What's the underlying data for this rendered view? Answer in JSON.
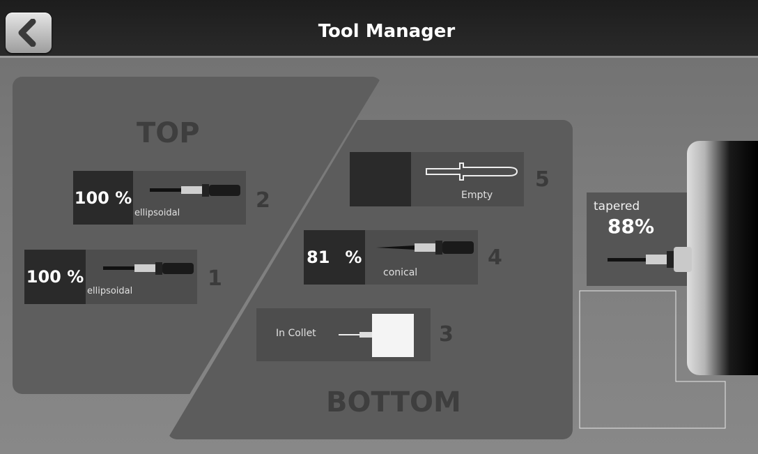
{
  "header": {
    "title": "Tool Manager",
    "back_icon": "back-arrow-icon"
  },
  "top": {
    "label": "TOP",
    "slots": [
      {
        "number": "2",
        "percent": "100 %",
        "type": "ellipsoidal"
      },
      {
        "number": "1",
        "percent": "100 %",
        "type": "ellipsoidal"
      }
    ]
  },
  "bottom": {
    "label": "BOTTOM",
    "slots": [
      {
        "number": "5",
        "status": "Empty"
      },
      {
        "number": "4",
        "percent_value": "81",
        "percent_sign": "%",
        "type": "conical"
      },
      {
        "number": "3",
        "status": "In Collet"
      }
    ]
  },
  "spindle": {
    "type": "tapered",
    "percent": "88%"
  },
  "colors": {
    "header": "#1d1d1d",
    "panel": "#5e5e5e",
    "slot": "#4d4d4d",
    "percent_box": "#2a2a2a"
  }
}
